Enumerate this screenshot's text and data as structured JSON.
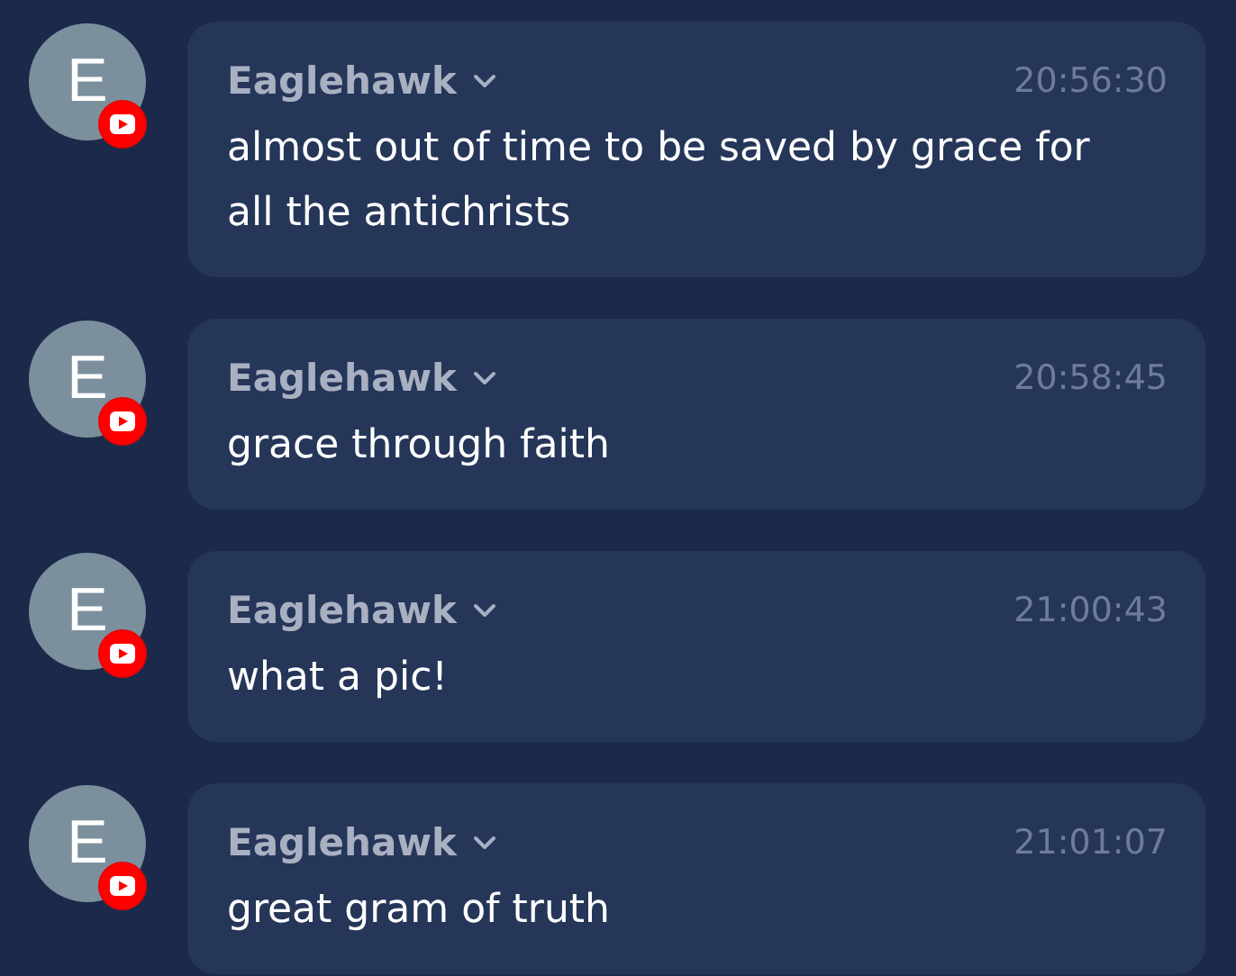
{
  "messages": [
    {
      "avatar": "E",
      "author": "Eaglehawk",
      "time": "20:56:30",
      "text": "almost out of time to be saved by grace for all the antichrists",
      "kind": "youtube"
    },
    {
      "avatar": "E",
      "author": "Eaglehawk",
      "time": "20:58:45",
      "text": "grace through faith",
      "kind": "youtube"
    },
    {
      "avatar": "E",
      "author": "Eaglehawk",
      "time": "21:00:43",
      "text": "what a pic!",
      "kind": "youtube"
    },
    {
      "avatar": "E",
      "author": "Eaglehawk",
      "time": "21:01:07",
      "text": "great gram of truth",
      "kind": "youtube"
    }
  ]
}
